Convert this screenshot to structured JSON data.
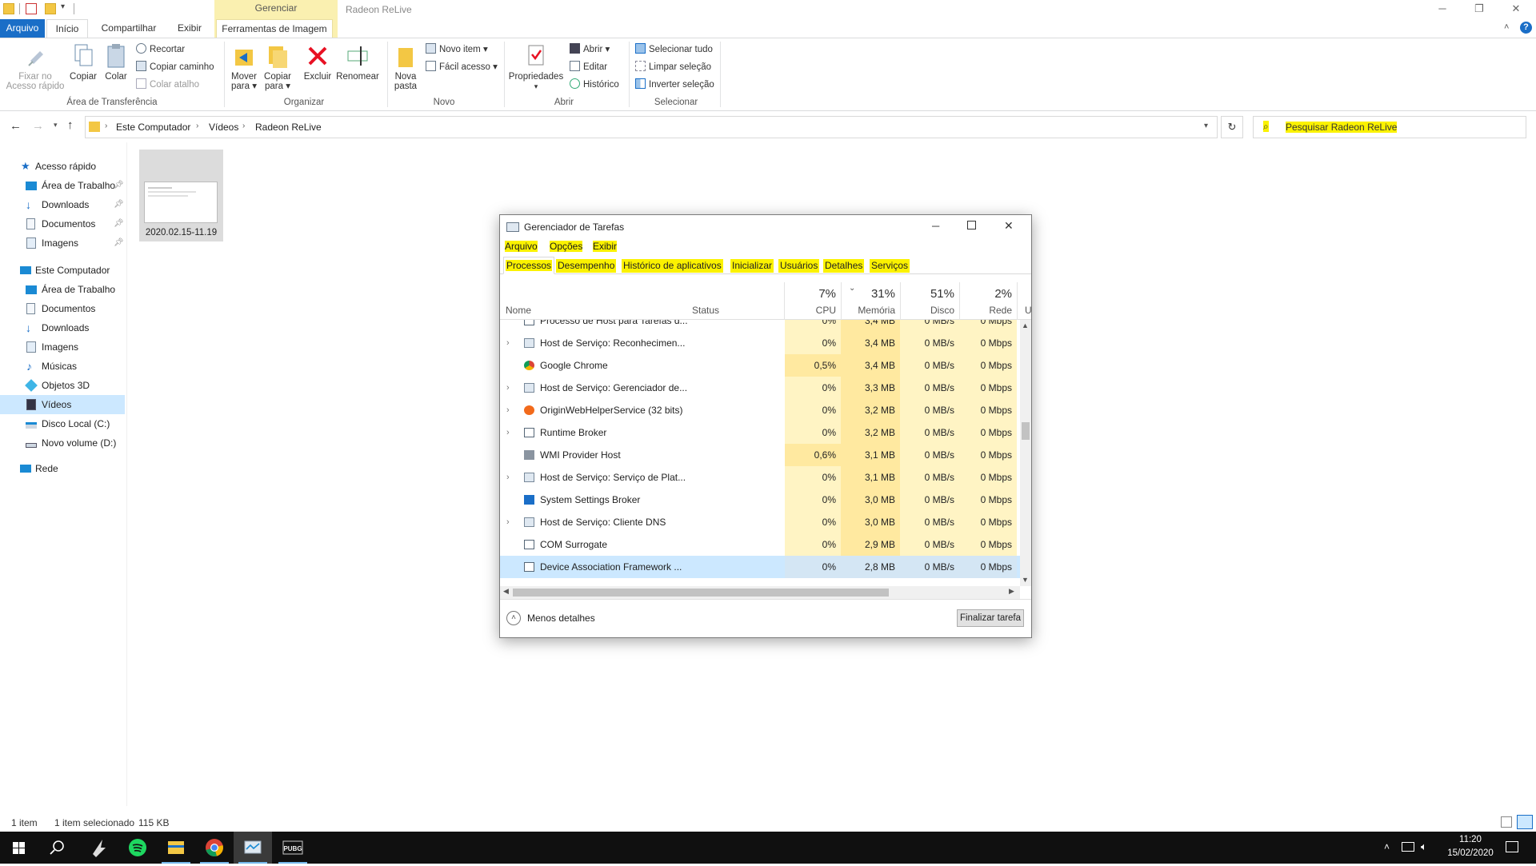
{
  "window": {
    "title": "Radeon ReLive",
    "context_tab_group": "Gerenciar"
  },
  "ribbon_tabs": [
    "Arquivo",
    "Início",
    "Compartilhar",
    "Exibir",
    "Ferramentas de Imagem"
  ],
  "ribbon": {
    "clipboard": {
      "pin_label": "Fixar no\nAcesso rápido",
      "copy": "Copiar",
      "paste": "Colar",
      "cut": "Recortar",
      "copy_path": "Copiar caminho",
      "paste_shortcut": "Colar atalho",
      "group": "Área de Transferência"
    },
    "organize": {
      "move": "Mover\npara ▾",
      "copyto": "Copiar\npara ▾",
      "delete": "Excluir",
      "rename": "Renomear",
      "group": "Organizar"
    },
    "new": {
      "new_folder": "Nova\npasta",
      "new_item": "Novo item ▾",
      "easy_access": "Fácil acesso ▾",
      "group": "Novo"
    },
    "open": {
      "properties": "Propriedades",
      "open": "Abrir ▾",
      "edit": "Editar",
      "history": "Histórico",
      "group": "Abrir"
    },
    "select": {
      "select_all": "Selecionar tudo",
      "clear": "Limpar seleção",
      "invert": "Inverter seleção",
      "group": "Selecionar"
    }
  },
  "address": {
    "crumbs": [
      "Este Computador",
      "Vídeos",
      "Radeon ReLive"
    ],
    "search_placeholder": "Pesquisar Radeon ReLive"
  },
  "nav": {
    "quick_access": "Acesso rápido",
    "quick_items": [
      "Área de Trabalho",
      "Downloads",
      "Documentos",
      "Imagens"
    ],
    "this_pc": "Este Computador",
    "pc_items": [
      "Área de Trabalho",
      "Documentos",
      "Downloads",
      "Imagens",
      "Músicas",
      "Objetos 3D",
      "Vídeos",
      "Disco Local (C:)",
      "Novo volume (D:)"
    ],
    "network": "Rede"
  },
  "files": [
    {
      "name": "2020.02.15-11.19"
    }
  ],
  "status": {
    "count": "1 item",
    "selected": "1 item selecionado",
    "size": "115 KB"
  },
  "taskmgr": {
    "title": "Gerenciador de Tarefas",
    "menu": [
      "Arquivo",
      "Opções",
      "Exibir"
    ],
    "tabs": [
      "Processos",
      "Desempenho",
      "Histórico de aplicativos",
      "Inicializar",
      "Usuários",
      "Detalhes",
      "Serviços"
    ],
    "columns": {
      "name": "Nome",
      "status": "Status",
      "cpu_pct": "7%",
      "cpu": "CPU",
      "mem_pct": "31%",
      "mem": "Memória",
      "disk_pct": "51%",
      "disk": "Disco",
      "net_pct": "2%",
      "net": "Rede",
      "more": "U"
    },
    "rows": [
      {
        "name": "Processo de Host para Tarefas d...",
        "cpu": "0%",
        "mem": "3,4 MB",
        "disk": "0 MB/s",
        "net": "0 Mbps",
        "expand": false,
        "icon": "window-icon"
      },
      {
        "name": "Host de Serviço: Reconhecimen...",
        "cpu": "0%",
        "mem": "3,4 MB",
        "disk": "0 MB/s",
        "net": "0 Mbps",
        "expand": true,
        "icon": "gear-icon"
      },
      {
        "name": "Google Chrome",
        "cpu": "0,5%",
        "mem": "3,4 MB",
        "disk": "0 MB/s",
        "net": "0 Mbps",
        "expand": false,
        "icon": "chrome-icon"
      },
      {
        "name": "Host de Serviço: Gerenciador de...",
        "cpu": "0%",
        "mem": "3,3 MB",
        "disk": "0 MB/s",
        "net": "0 Mbps",
        "expand": true,
        "icon": "gear-icon"
      },
      {
        "name": "OriginWebHelperService (32 bits)",
        "cpu": "0%",
        "mem": "3,2 MB",
        "disk": "0 MB/s",
        "net": "0 Mbps",
        "expand": true,
        "icon": "origin-icon"
      },
      {
        "name": "Runtime Broker",
        "cpu": "0%",
        "mem": "3,2 MB",
        "disk": "0 MB/s",
        "net": "0 Mbps",
        "expand": true,
        "icon": "window-icon"
      },
      {
        "name": "WMI Provider Host",
        "cpu": "0,6%",
        "mem": "3,1 MB",
        "disk": "0 MB/s",
        "net": "0 Mbps",
        "expand": false,
        "icon": "wmi-icon"
      },
      {
        "name": "Host de Serviço: Serviço de Plat...",
        "cpu": "0%",
        "mem": "3,1 MB",
        "disk": "0 MB/s",
        "net": "0 Mbps",
        "expand": true,
        "icon": "gear-icon"
      },
      {
        "name": "System Settings Broker",
        "cpu": "0%",
        "mem": "3,0 MB",
        "disk": "0 MB/s",
        "net": "0 Mbps",
        "expand": false,
        "icon": "settings-icon"
      },
      {
        "name": "Host de Serviço: Cliente DNS",
        "cpu": "0%",
        "mem": "3,0 MB",
        "disk": "0 MB/s",
        "net": "0 Mbps",
        "expand": true,
        "icon": "gear-icon"
      },
      {
        "name": "COM Surrogate",
        "cpu": "0%",
        "mem": "2,9 MB",
        "disk": "0 MB/s",
        "net": "0 Mbps",
        "expand": false,
        "icon": "window-icon"
      },
      {
        "name": "Device Association Framework ...",
        "cpu": "0%",
        "mem": "2,8 MB",
        "disk": "0 MB/s",
        "net": "0 Mbps",
        "expand": false,
        "icon": "window-icon",
        "selected": true
      }
    ],
    "fewer_details": "Menos detalhes",
    "end_task": "Finalizar tarefa"
  },
  "clock": {
    "time": "11:20",
    "date": "15/02/2020"
  },
  "colors": {
    "highlight": "#fbf200",
    "accent": "#1a6ec7",
    "selection": "#cce8ff",
    "heat": "#fff4c4"
  }
}
